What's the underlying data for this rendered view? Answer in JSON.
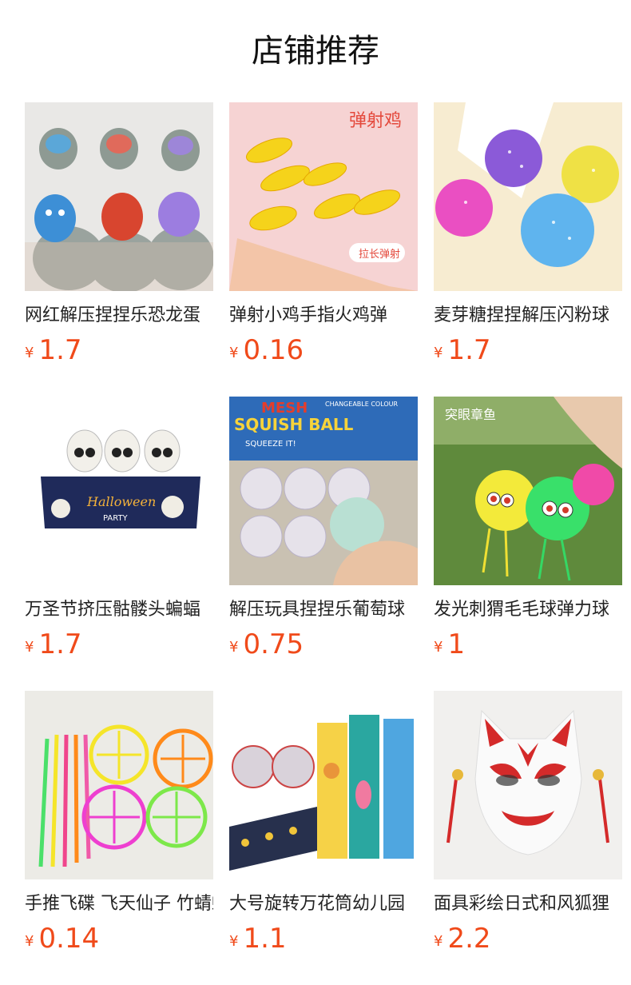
{
  "header": {
    "title": "店铺推荐"
  },
  "currency_symbol": "¥",
  "products": [
    {
      "name": "网红解压捏捏乐恐龙蛋",
      "price": "1.7",
      "image_icon": "dinosaur-egg-squeeze-toy"
    },
    {
      "name": "弹射小鸡手指火鸡弹",
      "price": "0.16",
      "image_icon": "slingshot-chicken-toy",
      "image_text": [
        "弹射鸡",
        "拉长弹射"
      ]
    },
    {
      "name": "麦芽糖捏捏解压闪粉球",
      "price": "1.7",
      "image_icon": "glitter-squeeze-ball"
    },
    {
      "name": "万圣节挤压骷髅头蝙蝠",
      "price": "1.7",
      "image_icon": "halloween-skull-squeeze",
      "image_text": [
        "Halloween",
        "PARTY"
      ]
    },
    {
      "name": "解压玩具捏捏乐葡萄球",
      "price": "0.75",
      "image_icon": "grape-mesh-squish-ball",
      "image_text": [
        "MESH",
        "SQUISH BALL",
        "SQUEEZE IT!",
        "CHANGEABLE COLOUR"
      ]
    },
    {
      "name": "发光刺猬毛毛球弹力球",
      "price": "1",
      "image_icon": "light-up-puffer-ball",
      "image_text": [
        "突眼章鱼"
      ]
    },
    {
      "name": "手推飞碟 飞天仙子 竹蜻蜓",
      "price": "0.14",
      "image_icon": "push-flying-disc-toy"
    },
    {
      "name": "大号旋转万花筒幼儿园",
      "price": "1.1",
      "image_icon": "kaleidoscope-toy"
    },
    {
      "name": "面具彩绘日式和风狐狸",
      "price": "2.2",
      "image_icon": "fox-mask"
    }
  ]
}
